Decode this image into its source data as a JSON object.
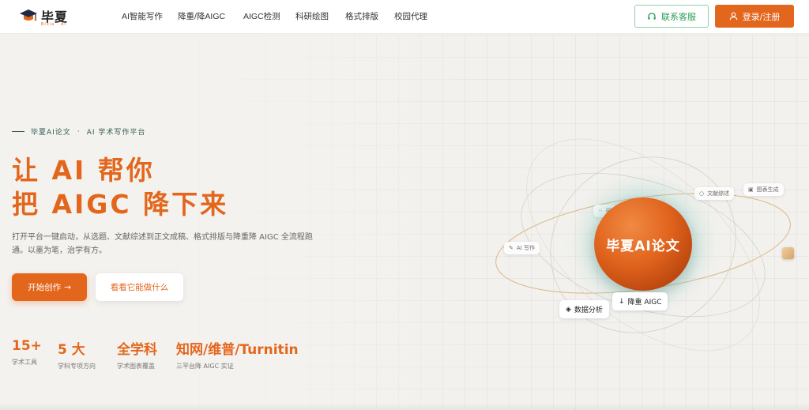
{
  "header": {
    "logo_text": "毕夏",
    "logo_sub": "Bixia · AI",
    "nav": [
      "AI智能写作",
      "降重/降AIGC",
      "AIGC检测",
      "科研绘图",
      "格式排版",
      "校园代理"
    ],
    "service_label": "联系客服",
    "login_label": "登录/注册"
  },
  "hero": {
    "tagline_brand": "毕夏AI论文",
    "tagline_sep": "·",
    "tagline_desc": "AI 学术写作平台",
    "headline_1": "让 AI 帮你",
    "headline_2": "把 AIGC 降下来",
    "description": "打开平台一键启动，从选题、文献综述到正文成稿、格式排版与降重降 AIGC 全流程跑通。以墨为笔，治学有方。",
    "start_label": "开始创作",
    "start_arrow": "→",
    "see_label": "看看它能做什么",
    "stats": [
      {
        "value": "15+",
        "label": "学术工具"
      },
      {
        "value": "5 大",
        "label": "学科专项方向"
      },
      {
        "value": "全学科",
        "label": "学术图表覆盖"
      },
      {
        "value": "知网/维普/Turnitin",
        "label": "三平台降 AIGC 实证"
      }
    ]
  },
  "visual": {
    "sphere_label": "毕夏AI论文",
    "chips": {
      "literature": "文献综述",
      "chart": "图表生成",
      "ai_write": "AI 写作",
      "reduce": "降重 AIGC",
      "data": "数据分析",
      "partial": "研"
    },
    "icons": {
      "literature": "○",
      "chart": "▣",
      "ai_write": "✎",
      "reduce": "↓",
      "data": "◈"
    }
  },
  "colors": {
    "accent": "#e3661d",
    "service_green": "#2aa05a",
    "tagline_teal": "#2f5a52"
  }
}
